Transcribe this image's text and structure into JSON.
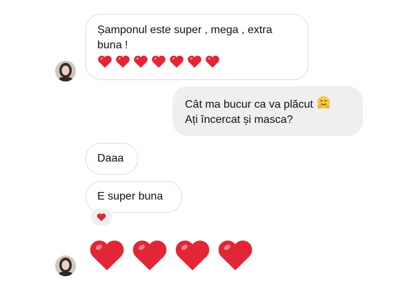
{
  "conversation": {
    "messages": [
      {
        "sender": "contact",
        "text_line1": "Șamponul este super , mega , extra",
        "text_line2": "buna !",
        "hearts_count": 7
      },
      {
        "sender": "me",
        "text_line1": "Cât ma bucur ca va plăcut",
        "text_line2": "Ați încercat și masca?",
        "emoji": "smiling-face-with-open-hands"
      },
      {
        "sender": "contact",
        "text": "Daaa"
      },
      {
        "sender": "contact",
        "text": "E super buna",
        "reaction": "red-heart"
      },
      {
        "sender": "contact",
        "big_hearts_count": 4
      }
    ]
  },
  "colors": {
    "heart": "#e32636",
    "incoming_border": "#dcdcdc",
    "outgoing_bg": "#efefef"
  },
  "icons": {
    "heart": "red-heart-icon",
    "hug": "hugging-face-icon",
    "avatar": "contact-avatar"
  }
}
